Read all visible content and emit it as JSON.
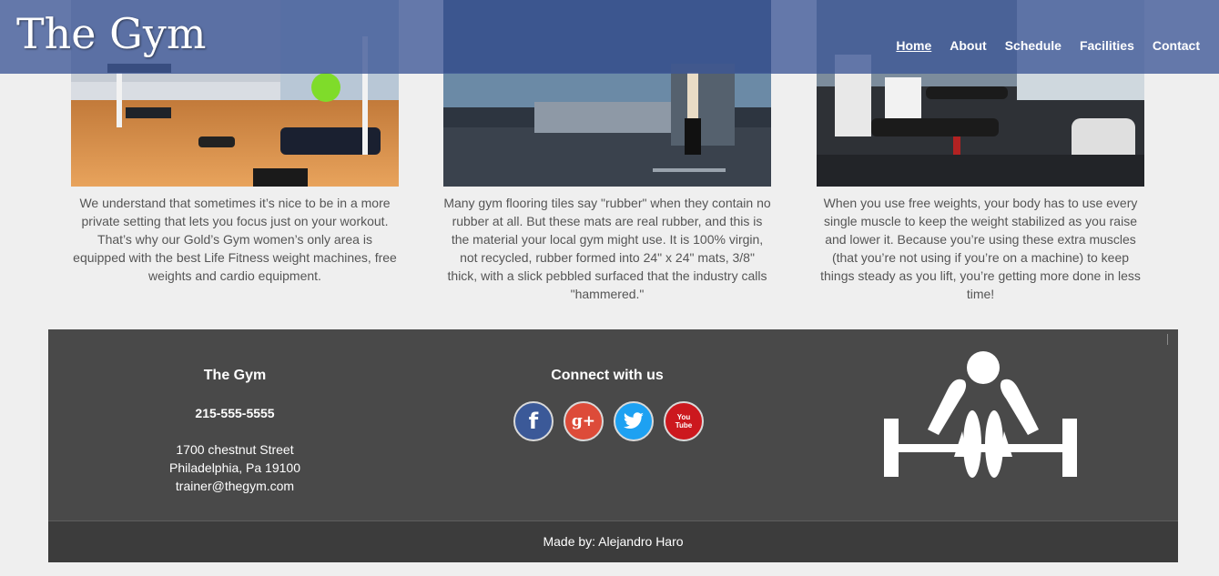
{
  "header": {
    "logo": "The Gym",
    "nav": [
      {
        "label": "Home",
        "active": true
      },
      {
        "label": "About"
      },
      {
        "label": "Schedule"
      },
      {
        "label": "Facilities"
      },
      {
        "label": "Contact"
      }
    ]
  },
  "columns": [
    {
      "text": "We understand that sometimes it’s nice to be in a more private setting that lets you focus just on your workout. That’s why our Gold’s Gym women’s only area is equipped with the best Life Fitness weight machines, free weights and cardio equipment."
    },
    {
      "text": "Many gym flooring tiles say \"rubber\" when they contain no rubber at all. But these mats are real rubber, and this is the material your local gym might use. It is 100% virgin, not recycled, rubber formed into 24\" x 24\" mats, 3/8\" thick, with a slick pebbled surfaced that the industry calls \"hammered.\""
    },
    {
      "text": "When you use free weights, your body has to use every single muscle to keep the weight stabilized as you raise and lower it. Because you’re using these extra muscles (that you’re not using if you’re on a machine) to keep things steady as you lift, you’re getting more done in less time!"
    }
  ],
  "footer": {
    "brand": "The Gym",
    "phone": "215-555-5555",
    "address_line1": "1700 chestnut Street",
    "address_line2": "Philadelphia, Pa 19100",
    "email": "trainer@thegym.com",
    "connect_heading": "Connect with us",
    "socials": [
      {
        "icon": "facebook-icon",
        "glyph": "f",
        "color": "#3b5998"
      },
      {
        "icon": "google-plus-icon",
        "glyph": "g+",
        "color": "#dd4b39"
      },
      {
        "icon": "twitter-icon",
        "glyph": "t",
        "color": "#1da1f2"
      },
      {
        "icon": "youtube-icon",
        "glyph": "You Tube",
        "color": "#cc181e"
      }
    ],
    "credit": "Made by: Alejandro Haro"
  },
  "colors": {
    "header_bg": "#3c5696",
    "footer_bg": "#494949",
    "footer_bottom_bg": "#3c3c3c",
    "page_bg": "#efefef"
  }
}
